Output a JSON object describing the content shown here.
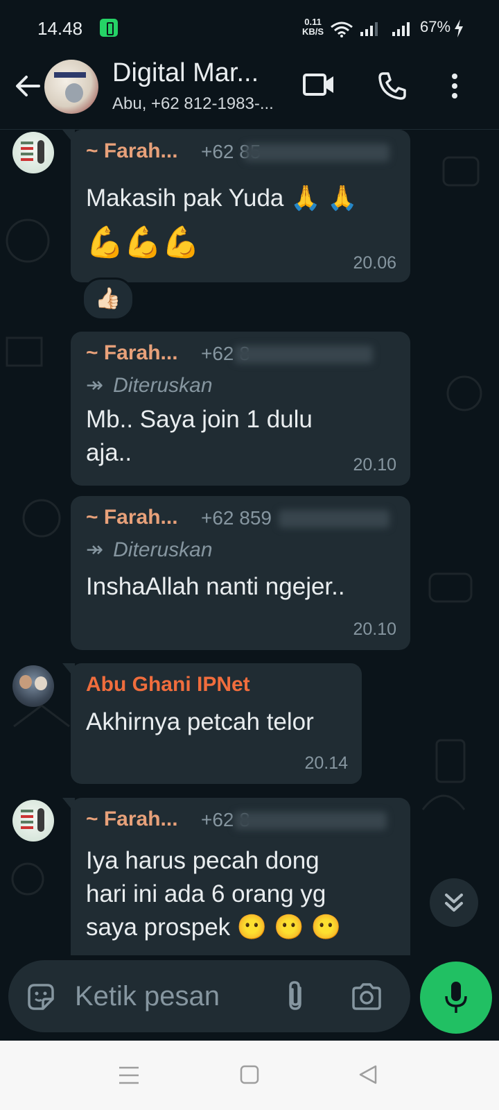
{
  "status_bar": {
    "time": "14.48",
    "net_speed_value": "0.11",
    "net_speed_unit": "KB/S",
    "battery_percent": "67%"
  },
  "header": {
    "group_name": "Digital Mar...",
    "members_preview": "Abu, +62 812-1983-..."
  },
  "colors": {
    "background": "#0b141a",
    "bubble": "#202c33",
    "farah_name": "#e8a17a",
    "abu_name": "#f06d3d",
    "accent_green": "#21c063",
    "meta_gray": "#8696a0"
  },
  "messages": [
    {
      "sender": "~ Farah...",
      "phone_visible": "+62 85",
      "forwarded": false,
      "text_lines": [
        "Makasih pak Yuda 🙏 🙏",
        "💪💪💪"
      ],
      "time": "20.06",
      "reaction": "👍🏻"
    },
    {
      "sender": "~ Farah...",
      "phone_visible": "+62 8",
      "forwarded": true,
      "forward_label": "Diteruskan",
      "text_lines": [
        "Mb.. Saya join 1 dulu",
        "aja.."
      ],
      "time": "20.10"
    },
    {
      "sender": "~ Farah...",
      "phone_visible": "+62 859",
      "forwarded": true,
      "forward_label": "Diteruskan",
      "text_lines": [
        "InshaAllah nanti ngejer.."
      ],
      "time": "20.10"
    },
    {
      "sender": "Abu Ghani IPNet",
      "forwarded": false,
      "text_lines": [
        "Akhirnya petcah telor"
      ],
      "time": "20.14"
    },
    {
      "sender": "~ Farah...",
      "phone_visible": "+62 8",
      "forwarded": false,
      "text_lines": [
        "Iya harus pecah dong",
        "hari ini ada 6 orang yg",
        "saya prospek 😶 😶 😶"
      ],
      "time": ""
    }
  ],
  "composer": {
    "placeholder": "Ketik pesan"
  },
  "icons": {
    "back": "arrow-left-icon",
    "video": "video-call-icon",
    "call": "phone-icon",
    "menu": "more-vert-icon",
    "sticker": "sticker-icon",
    "attach": "paperclip-icon",
    "camera": "camera-icon",
    "mic": "mic-icon",
    "scroll": "double-chevron-down-icon"
  }
}
